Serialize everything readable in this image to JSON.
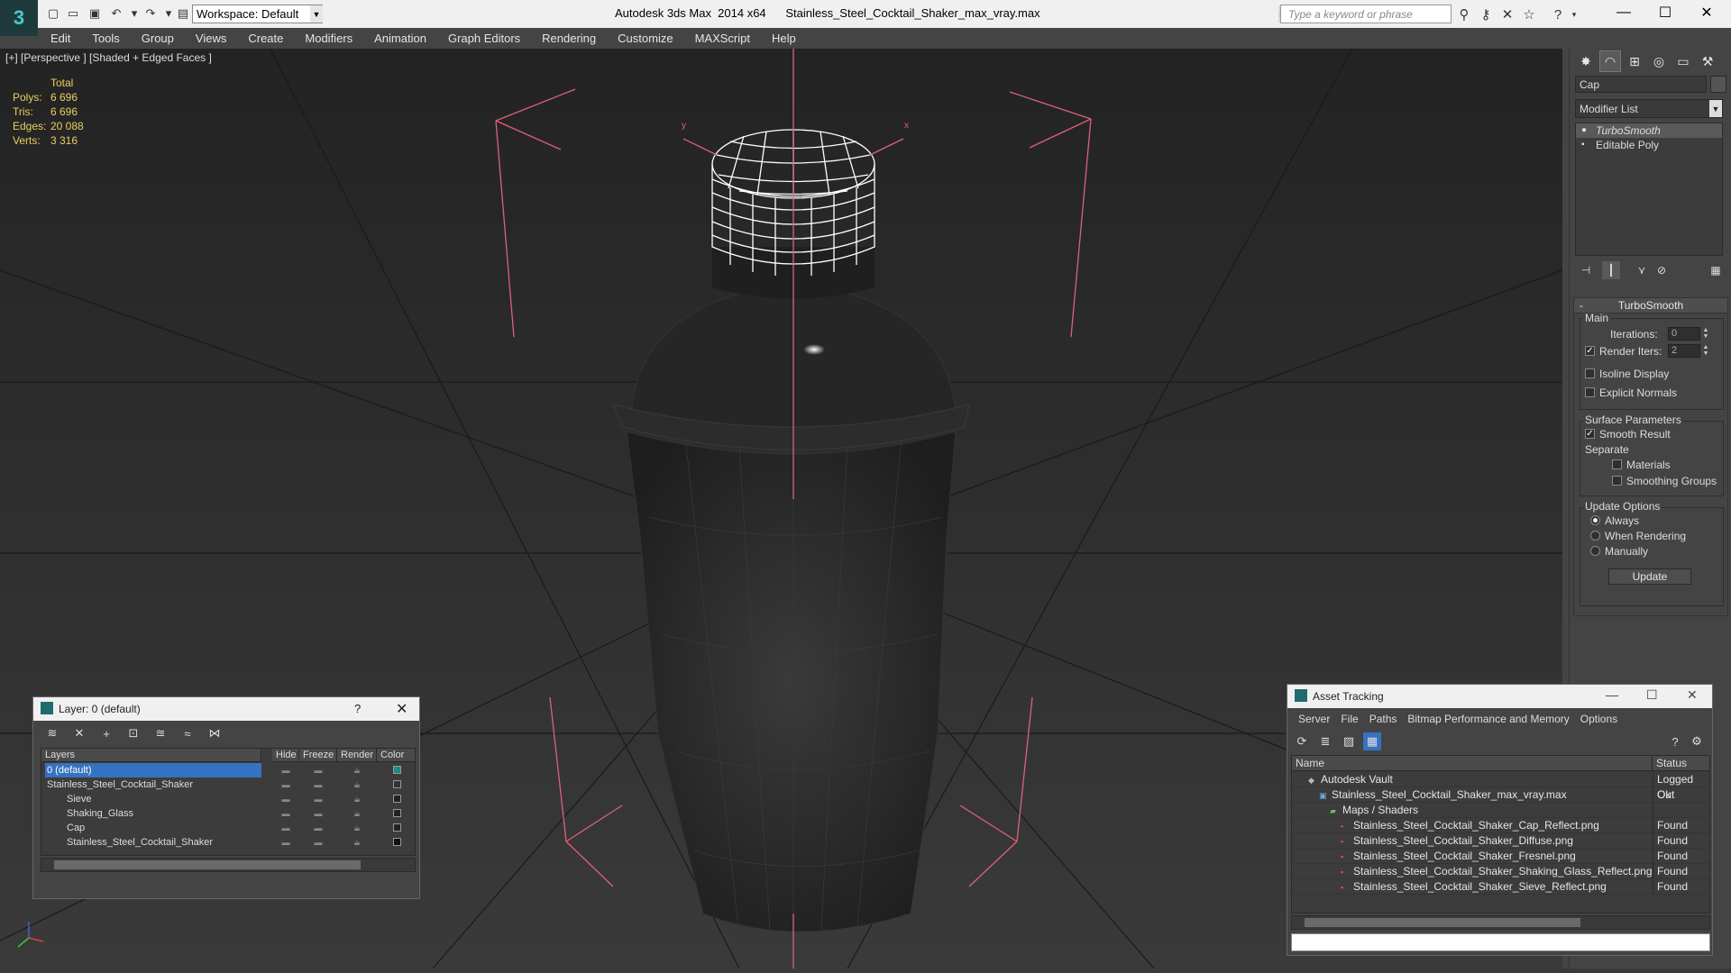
{
  "app": {
    "title": "Autodesk 3ds Max  2014 x64      Stainless_Steel_Cocktail_Shaker_max_vray.max",
    "workspace": "Workspace: Default",
    "search_placeholder": "Type a keyword or phrase"
  },
  "menu": [
    "Edit",
    "Tools",
    "Group",
    "Views",
    "Create",
    "Modifiers",
    "Animation",
    "Graph Editors",
    "Rendering",
    "Customize",
    "MAXScript",
    "Help"
  ],
  "viewport": {
    "label": "[+] [Perspective ] [Shaded + Edged Faces ]",
    "stats": {
      "total_label": "Total",
      "rows": [
        {
          "label": "Polys:",
          "value": "6 696"
        },
        {
          "label": "Tris:",
          "value": "6 696"
        },
        {
          "label": "Edges:",
          "value": "20 088"
        },
        {
          "label": "Verts:",
          "value": "3 316"
        }
      ]
    },
    "gizmo_x": "x",
    "gizmo_y": "y"
  },
  "command_panel": {
    "object_name": "Cap",
    "modifier_list": "Modifier List",
    "stack": [
      {
        "label": "TurboSmooth",
        "selected": true
      },
      {
        "label": "Editable Poly",
        "selected": false
      }
    ],
    "rollout_title": "TurboSmooth",
    "main_group": "Main",
    "iterations_label": "Iterations:",
    "iterations_value": "0",
    "render_iters_label": "Render Iters:",
    "render_iters_value": "2",
    "isoline_label": "Isoline Display",
    "explicit_normals_label": "Explicit Normals",
    "surface_group": "Surface Parameters",
    "smooth_result_label": "Smooth Result",
    "separate_label": "Separate",
    "materials_label": "Materials",
    "smoothing_groups_label": "Smoothing Groups",
    "update_group": "Update Options",
    "always_label": "Always",
    "when_rendering_label": "When Rendering",
    "manually_label": "Manually",
    "update_button": "Update"
  },
  "layer_dialog": {
    "title": "Layer: 0 (default)",
    "help": "?",
    "columns": [
      "Layers",
      "Hide",
      "Freeze",
      "Render",
      "Color"
    ],
    "rows": [
      {
        "name": "0 (default)",
        "indent": 1,
        "selected": true,
        "color": "#1f8a8a"
      },
      {
        "name": "Stainless_Steel_Cocktail_Shaker",
        "indent": 1,
        "selected": false,
        "color": "#333333"
      },
      {
        "name": "Sieve",
        "indent": 2,
        "selected": false,
        "color": "#222222"
      },
      {
        "name": "Shaking_Glass",
        "indent": 2,
        "selected": false,
        "color": "#222222"
      },
      {
        "name": "Cap",
        "indent": 2,
        "selected": false,
        "color": "#222222"
      },
      {
        "name": "Stainless_Steel_Cocktail_Shaker",
        "indent": 2,
        "selected": false,
        "color": "#111111"
      }
    ]
  },
  "asset_dialog": {
    "title": "Asset Tracking",
    "menu": [
      "Server",
      "File",
      "Paths",
      "Bitmap Performance and Memory",
      "Options"
    ],
    "columns": [
      "Name",
      "Status"
    ],
    "rows": [
      {
        "name": "Autodesk Vault",
        "indent": 1,
        "status": "Logged Out",
        "icon": "vault-icon"
      },
      {
        "name": "Stainless_Steel_Cocktail_Shaker_max_vray.max",
        "indent": 2,
        "status": "Ok",
        "icon": "max-file-icon"
      },
      {
        "name": "Maps / Shaders",
        "indent": 3,
        "status": "",
        "icon": "folder-icon"
      },
      {
        "name": "Stainless_Steel_Cocktail_Shaker_Cap_Reflect.png",
        "indent": 4,
        "status": "Found",
        "icon": "png-icon"
      },
      {
        "name": "Stainless_Steel_Cocktail_Shaker_Diffuse.png",
        "indent": 4,
        "status": "Found",
        "icon": "png-icon"
      },
      {
        "name": "Stainless_Steel_Cocktail_Shaker_Fresnel.png",
        "indent": 4,
        "status": "Found",
        "icon": "png-icon"
      },
      {
        "name": "Stainless_Steel_Cocktail_Shaker_Shaking_Glass_Reflect.png",
        "indent": 4,
        "status": "Found",
        "icon": "png-icon"
      },
      {
        "name": "Stainless_Steel_Cocktail_Shaker_Sieve_Reflect.png",
        "indent": 4,
        "status": "Found",
        "icon": "png-icon"
      }
    ]
  },
  "colors": {
    "selection_box": "#e0607a",
    "stats_text": "#e8d060",
    "highlight": "#3572c0"
  }
}
